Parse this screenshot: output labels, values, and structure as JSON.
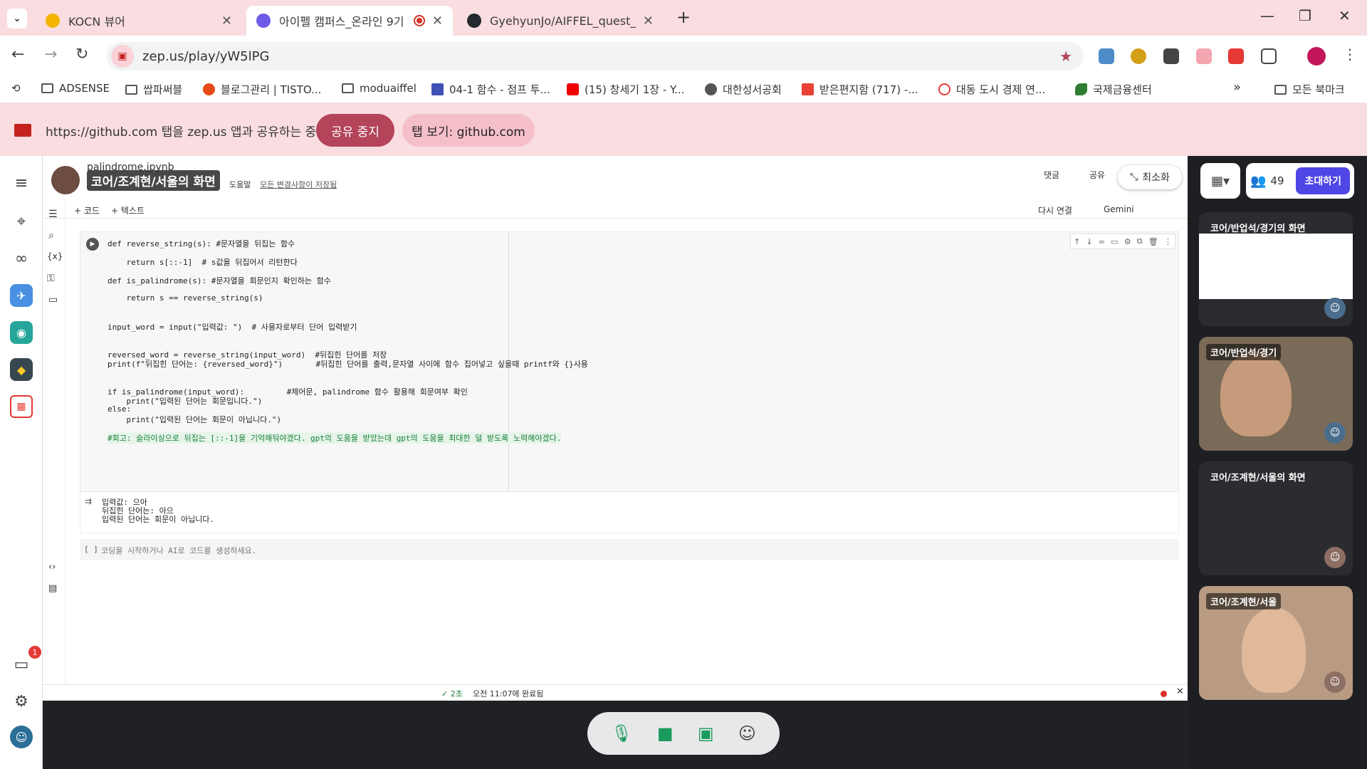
{
  "browser": {
    "tabs": [
      {
        "title": "KOCN 뷰어",
        "favicon_color": "#f4b400"
      },
      {
        "title": "아이펠 캠퍼스_온라인 9기",
        "favicon_color": "#6c5ce7",
        "active": true
      },
      {
        "title": "GyehyunJo/AIFFEL_quest_cr",
        "favicon_color": "#24292f"
      }
    ],
    "new_tab": "+",
    "url": "zep.us/play/yW5lPG",
    "bookmarks": [
      "ADSENSE",
      "쌉파써블",
      "블로그관리 | TISTO...",
      "moduaiffel",
      "04-1 함수 - 점프 투...",
      "(15) 창세기 1장 - Y...",
      "대한성서공회",
      "받은편지함 (717) -...",
      "대동 도시 경제 연...",
      "국제금융센터"
    ],
    "bookmarks_more": "»",
    "all_bookmarks": "모든 북마크"
  },
  "sharebar": {
    "text": "https://github.com 탭을 zep.us 앱과 공유하는 중",
    "stop_label": "공유 중지",
    "view_label": "탭 보기: github.com"
  },
  "stage": {
    "screen_label": "코어/조계현/서울의 화면",
    "minimize_label": "최소화",
    "notebook_title": "palindrome.ipynb",
    "menu_help": "도움말",
    "saved_text": "모든 변경사항이 저장됨",
    "comments": "댓글",
    "share": "공유",
    "add_code": "+ 코드",
    "add_text": "+ 텍스트",
    "reconnect": "다시 연결",
    "gemini": "Gemini",
    "code_lines": [
      "def reverse_string(s): #문자열을 뒤집는 함수",
      "    return s[::-1]  # s값을 뒤집어서 리턴한다",
      "def is_palindrome(s): #문자열을 회문인지 확인하는 함수",
      "    return s == reverse_string(s)",
      "input_word = input(\"입력값: \")  # 사용자로부터 단어 입력받기",
      "reversed_word = reverse_string(input_word)  #뒤집힌 단어를 저장",
      "print(f\"뒤집힌 단어는: {reversed_word}\")       #뒤집힌 단어를 출력,문자열 사이에 함수 집어넣고 싶을때 printf와 {}사용",
      "if is_palindrome(input_word):         #제어문, palindrome 함수 활용해 회문여부 확인",
      "    print(\"입력된 단어는 회문입니다.\")",
      "else:",
      "    print(\"입력된 단어는 회문이 아닙니다.\")",
      "#회고: 슬라이싱으로 뒤집는 [::-1]을 기억해둬야겠다. gpt의 도움을 받았는데 gpt의 도움을 최대한 덜 받도록 노력해야겠다."
    ],
    "output_lines": [
      "입력값: 으아",
      "뒤집힌 단어는: 아으",
      "입력된 단어는 회문이 아닙니다."
    ],
    "empty_cell_hint": "코딩을 시작하거나 AI로 코드를 생성하세요.",
    "empty_cell_bracket": "[ ]",
    "status_time": "✓ 2초",
    "status_done": "오전 11:07에 완료됨"
  },
  "zep": {
    "user_count": "49",
    "invite_label": "초대하기",
    "chat_badge": "1",
    "tiles": [
      {
        "label": "코어/반업석/경기의 화면",
        "type": "screen"
      },
      {
        "label": "코어/반업석/경기",
        "type": "camera"
      },
      {
        "label": "코어/조계현/서울의 화면",
        "type": "screen-empty"
      },
      {
        "label": "코어/조계현/서울",
        "type": "camera"
      }
    ]
  }
}
